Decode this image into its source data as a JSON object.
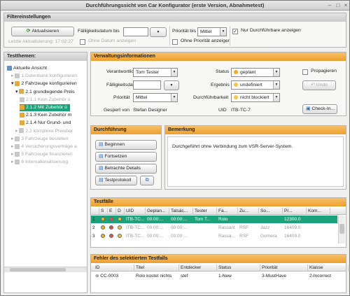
{
  "window": {
    "title": "Durchführungssicht von Car Konfigurator (erste Version, Abnahmetest)"
  },
  "filter": {
    "header": "Filtereinstellungen",
    "refresh_label": "Aktualisieren",
    "last_refresh": "Letzte Aktualisierung: 17:02:27",
    "due_label": "Fälligkeitsdatum bis",
    "due_value": "",
    "no_date_label": "Ohne Datum anzeigen",
    "priority_label": "Priorität bis",
    "priority_value": "Mittel",
    "no_priority_label": "Ohne Priorität anzeigen",
    "executable_only_label": "Nur Durchführbare anzeigen"
  },
  "tree": {
    "header": "Testthemen:",
    "items": [
      {
        "label": "Aktuelle Ansicht",
        "disabled": false
      },
      {
        "label": "1 Datenbank konfigurieren",
        "disabled": true
      },
      {
        "label": "2 Fahrzeuge konfigurieren",
        "disabled": false
      },
      {
        "label": "2.1 grundlegende Preis",
        "disabled": false
      },
      {
        "label": "2.1.1 Kein Zubehör ü",
        "disabled": true
      },
      {
        "label": "2.1.2 Mit Zubehör ü",
        "disabled": false,
        "selected": true
      },
      {
        "label": "2.1.3 Kein Zubehör m",
        "disabled": false
      },
      {
        "label": "2.1.4 Nur Grund- und",
        "disabled": false
      },
      {
        "label": "2.2 komplexe Preisber",
        "disabled": true
      },
      {
        "label": "3 Fahrzeuge bestellen",
        "disabled": true
      },
      {
        "label": "4 Versicherungsverträge a",
        "disabled": true
      },
      {
        "label": "5 Fahrzeuge finanzieren",
        "disabled": true
      },
      {
        "label": "6 Internationalisierung",
        "disabled": true
      }
    ]
  },
  "admin": {
    "header": "Verwaltungsinformationen",
    "responsible_label": "Verantwortlicher",
    "responsible_value": "Tom Tester",
    "due_label": "Fälligkeitsdatum",
    "due_value": "",
    "priority_label": "Priorität",
    "priority_value": "Mittel",
    "designer_label": "Gespert von",
    "designer_value": "Stefan Designer",
    "status_label": "Status",
    "status_value": "geplant",
    "result_label": "Ergebnis",
    "result_value": "undefiniert",
    "exec_label": "Durchführbarkeit",
    "exec_value": "nicht blockiert",
    "uid_label": "UID",
    "uid_value": "ITB-TC-7",
    "propagate_label": "Propagieren",
    "undo_label": "Undo",
    "checkin_label": "Check-In..."
  },
  "execution": {
    "header": "Durchführung",
    "begin_label": "Beginnen",
    "continue_label": "Fortsetzen",
    "details_label": "Betrachte Details",
    "protocol_label": "Testprotokoll"
  },
  "remark": {
    "header": "Bemerkung",
    "text": "Durchgeführt ohne Verbindung zum VSR-Server-System."
  },
  "testcases": {
    "header": "Testfälle",
    "columns": [
      "S",
      "E",
      "D",
      "UID",
      "Geplan...",
      "Tatsäc...",
      "Tester",
      "Fa...",
      "Zu...",
      "So...",
      "Pr...",
      "Kom..."
    ],
    "rows": [
      {
        "n": "1",
        "uid": "ITB-TC...",
        "planned": "00:00:...",
        "actual": "00:00:...",
        "tester": "Tom T...",
        "fa": "Rolo",
        "zu": "",
        "so": "",
        "pr": "12300.0",
        "selected": true
      },
      {
        "n": "2",
        "uid": "ITB-TC...",
        "planned": "00:00:...",
        "actual": "00:00:...",
        "tester": "",
        "fa": "Rassant",
        "zu": "RSF",
        "so": "Jazz",
        "pr": "16409.0",
        "selected": false
      },
      {
        "n": "3",
        "uid": "ITB-TC...",
        "planned": "00:00:...",
        "actual": "00:00:...",
        "tester": "",
        "fa": "Rassa...",
        "zu": "RSF",
        "so": "Gomera",
        "pr": "16409.0",
        "selected": false
      }
    ]
  },
  "errors": {
    "header": "Fehler des selektierten Testfalls",
    "columns": [
      "ID",
      "Titel",
      "Entdecker",
      "Status",
      "Priorität",
      "Klasse"
    ],
    "rows": [
      {
        "id": "CC-0003",
        "title": "Rolo kostet nichts",
        "finder": "stef",
        "status": "1-New",
        "priority": "3-MustHave",
        "class": "2-Incorrect"
      }
    ]
  },
  "colors": {
    "accent": "#ee9f2e",
    "selection": "#1aa37a",
    "status_planned": "#f0b020"
  }
}
